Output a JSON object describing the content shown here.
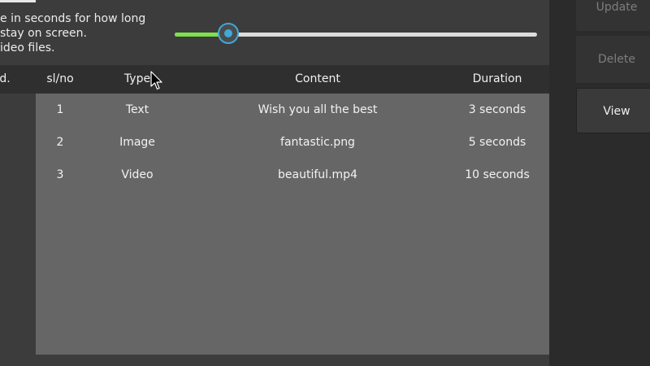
{
  "description": {
    "line1": "e in seconds for how long",
    "line2": "stay on screen.",
    "line3": "ideo files."
  },
  "slider": {
    "value_fraction": 0.15,
    "fill_color": "#7ee04a",
    "handle_color": "#3fa9d8"
  },
  "table": {
    "headers": {
      "partial": "d.",
      "slno": "sl/no",
      "type": "Type",
      "content": "Content",
      "duration": "Duration"
    },
    "rows": [
      {
        "slno": "1",
        "type": "Text",
        "content": "Wish you all the best",
        "duration": "3 seconds"
      },
      {
        "slno": "2",
        "type": "Image",
        "content": "fantastic.png",
        "duration": "5 seconds"
      },
      {
        "slno": "3",
        "type": "Video",
        "content": "beautiful.mp4",
        "duration": "10 seconds"
      }
    ]
  },
  "side_panel": {
    "update_label": "Update",
    "delete_label": "Delete",
    "view_label": "View"
  },
  "icons": {
    "cursor": "mouse-pointer-icon"
  }
}
